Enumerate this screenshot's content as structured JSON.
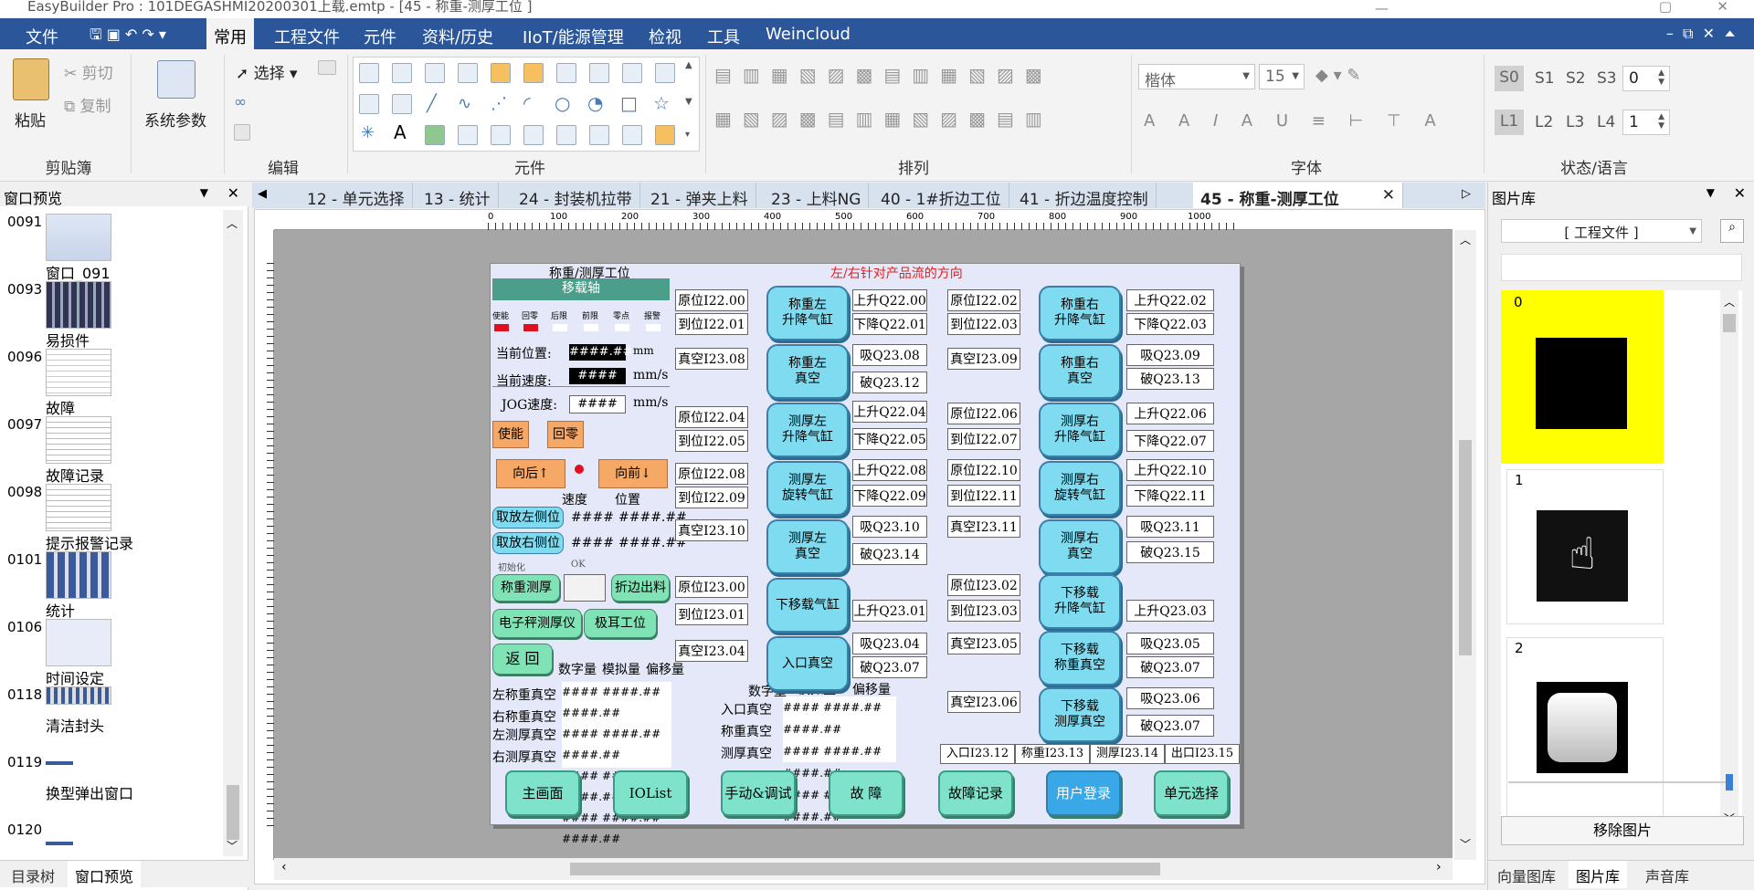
{
  "window": {
    "title": "EasyBuilder Pro : 101DEGASHMI20200301上载.emtp - [45 - 称重-测厚工位 ]"
  },
  "menu": [
    "文件",
    "常用",
    "工程文件",
    "元件",
    "资料/历史",
    "IIoT/能源管理",
    "检视",
    "工具",
    "Weincloud"
  ],
  "ribbon": {
    "clipboard": {
      "paste": "粘贴",
      "cut": "剪切",
      "copy": "复制",
      "group": "剪贴簿"
    },
    "sysparam": "系统参数",
    "edit": {
      "select": "选择",
      "group": "编辑"
    },
    "elements_group": "元件",
    "arrange_group": "排列",
    "font": {
      "name": "楷体",
      "size": "15",
      "group": "字体"
    },
    "state": {
      "s": [
        "S0",
        "S1",
        "S2",
        "S3"
      ],
      "s_value": "0",
      "l": [
        "L1",
        "L2",
        "L3",
        "L4"
      ],
      "l_value": "1",
      "group": "状态/语言"
    }
  },
  "left_panel": {
    "title": "窗口预览",
    "items": [
      {
        "num": "0091",
        "label": "窗口_091"
      },
      {
        "num": "0093",
        "label": "易损件"
      },
      {
        "num": "0096",
        "label": "故障"
      },
      {
        "num": "0097",
        "label": "故障记录"
      },
      {
        "num": "0098",
        "label": "提示报警记录"
      },
      {
        "num": "0101",
        "label": "统计"
      },
      {
        "num": "0106",
        "label": "时间设定"
      },
      {
        "num": "0118",
        "label": "清洁封头"
      },
      {
        "num": "0119",
        "label": "换型弹出窗口"
      },
      {
        "num": "0120",
        "label": ""
      }
    ],
    "tabs": [
      "目录树",
      "窗口预览"
    ]
  },
  "tabs": [
    "12 - 单元选择",
    "13 - 统计",
    "24 - 封装机拉带",
    "21 - 弹夹上料",
    "23 - 上料NG",
    "40 - 1#折边工位",
    "41 - 折边温度控制",
    "45 - 称重-测厚工位"
  ],
  "ruler": [
    "0",
    "100",
    "200",
    "300",
    "400",
    "500",
    "600",
    "700",
    "800",
    "900",
    "1000"
  ],
  "hmi": {
    "title": "称重/测厚工位",
    "flow_note": "左/右针对产品流的方向",
    "axis_header": "移载轴",
    "status_labels": [
      "使能",
      "回零",
      "后限",
      "前限",
      "零点",
      "报警"
    ],
    "pos_label": "当前位置:",
    "pos_value": "####.##",
    "pos_unit": "mm",
    "speed_label": "当前速度:",
    "speed_value": "####",
    "speed_unit": "mm/s",
    "jog_label": "JOG速度:",
    "jog_value": "####",
    "jog_unit": "mm/s",
    "enable": "使能",
    "home": "回零",
    "back": "向后↑",
    "fwd": "向前↓",
    "col_speed": "速度",
    "col_pos": "位置",
    "take_left": "取放左侧位",
    "take_right": "取放右侧位",
    "hash4": "####",
    "hash42": "####.##",
    "init": "初始化",
    "ok": "OK",
    "weigh_measure": "称重测厚",
    "fold_out": "折边出料",
    "e_thick": "电子秤测厚仪",
    "ear": "极耳工位",
    "back_btn": "返 回",
    "tbl_hdr": [
      "数字量",
      "模拟量",
      "偏移量"
    ],
    "tbl_rows": [
      "左称重真空",
      "右称重真空",
      "左测厚真空",
      "右测厚真空"
    ],
    "tbl2_rows": [
      "入口真空",
      "称重真空",
      "测厚真空"
    ],
    "io_col1": [
      "原位I22.00",
      "到位I22.01",
      "真空I23.08",
      "原位I22.04",
      "到位I22.05",
      "原位I22.08",
      "到位I22.09",
      "真空I23.10",
      "原位I23.00",
      "到位I23.01",
      "真空I23.04"
    ],
    "big_left": [
      "称重左\n升降气缸",
      "称重左\n真空",
      "测厚左\n升降气缸",
      "测厚左\n旋转气缸",
      "测厚左\n真空",
      "下移载气缸",
      "入口真空"
    ],
    "io_col2": [
      "上升Q22.00",
      "下降Q22.01",
      "吸Q23.08",
      "破Q23.12",
      "上升Q22.04",
      "下降Q22.05",
      "上升Q22.08",
      "下降Q22.09",
      "吸Q23.10",
      "破Q23.14",
      "上升Q23.01",
      "吸Q23.04",
      "破Q23.07"
    ],
    "io_col3": [
      "原位I22.02",
      "到位I22.03",
      "真空I23.09",
      "原位I22.06",
      "到位I22.07",
      "原位I22.10",
      "到位I22.11",
      "真空I23.11",
      "原位I23.02",
      "到位I23.03",
      "真空I23.05",
      "真空I23.06"
    ],
    "big_right": [
      "称重右\n升降气缸",
      "称重右\n真空",
      "测厚右\n升降气缸",
      "测厚右\n旋转气缸",
      "测厚右\n真空",
      "下移载\n升降气缸",
      "下移载\n称重真空",
      "下移载\n测厚真空"
    ],
    "io_col4": [
      "上升Q22.02",
      "下降Q22.03",
      "吸Q23.09",
      "破Q23.13",
      "上升Q22.06",
      "下降Q22.07",
      "上升Q22.10",
      "下降Q22.11",
      "吸Q23.11",
      "破Q23.15",
      "上升Q23.03",
      "吸Q23.05",
      "破Q23.07",
      "吸Q23.06",
      "破Q23.07"
    ],
    "bottom_io": [
      "入口I23.12",
      "称重I23.13",
      "测厚I23.14",
      "出口I23.15"
    ],
    "nav": [
      "主画面",
      "IOList",
      "手动&调试",
      "故 障",
      "故障记录",
      "用户登录",
      "单元选择"
    ]
  },
  "right_panel": {
    "title": "图片库",
    "combo": "[ 工程文件 ]",
    "items": [
      "0",
      "1",
      "2"
    ],
    "remove": "移除图片",
    "tabs": [
      "向量图库",
      "图片库",
      "声音库"
    ]
  },
  "colors": {
    "menubar": "#2b579a",
    "bigbtn": "#7fdcf0",
    "greenbtn": "#7fe3b5",
    "orange": "#f6a866",
    "hmi_bg": "#e5e8f8",
    "highlight": "#ffff00"
  }
}
